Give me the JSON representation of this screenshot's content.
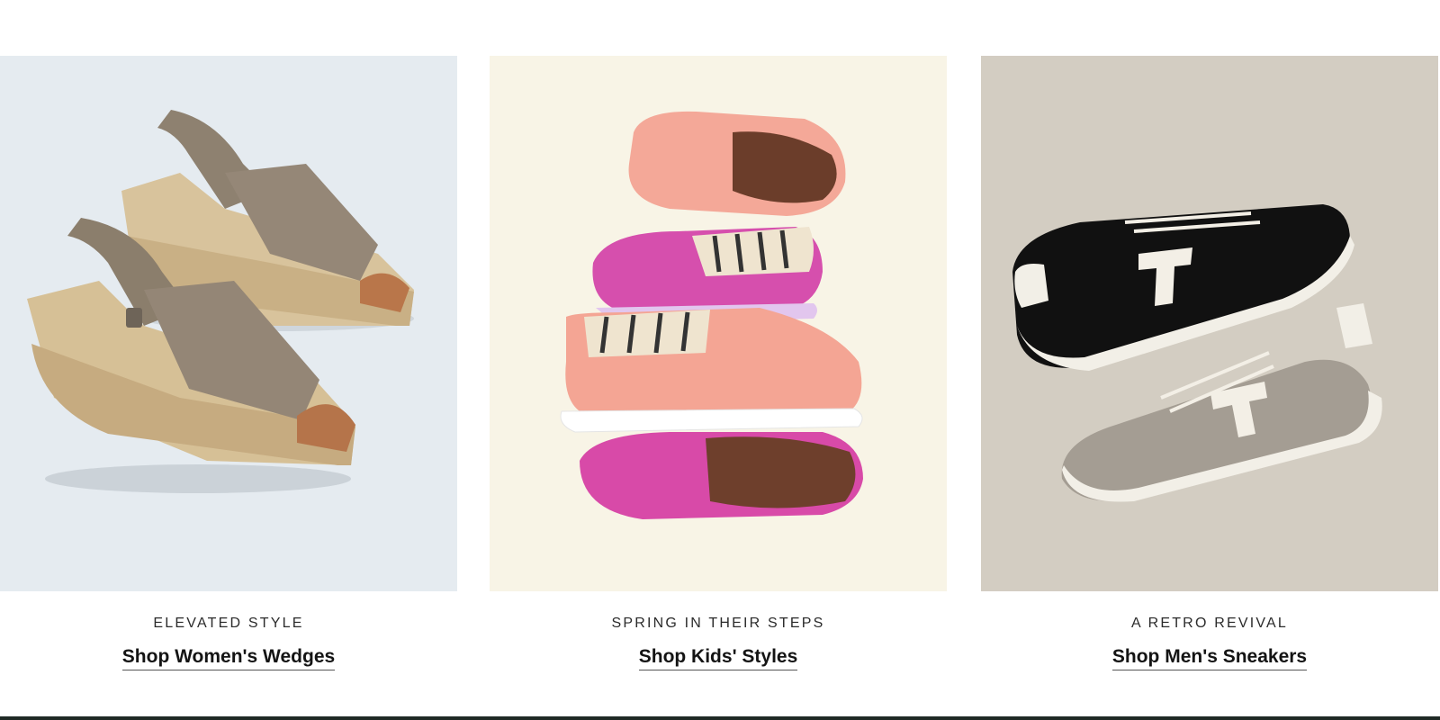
{
  "tiles": [
    {
      "eyebrow": "ELEVATED STYLE",
      "cta": "Shop Women's Wedges",
      "image_icon": "womens-wedge-sandals-photo",
      "background": "#e5ebf0"
    },
    {
      "eyebrow": "SPRING IN THEIR STEPS",
      "cta": "Shop Kids' Styles",
      "image_icon": "kids-slip-on-shoes-photo",
      "background": "#f8f4e6"
    },
    {
      "eyebrow": "A RETRO REVIVAL",
      "cta": "Shop Men's Sneakers",
      "image_icon": "mens-sneakers-photo",
      "background": "#d3cdc2"
    }
  ],
  "colors": {
    "text": "#2b2b2b",
    "link": "#141414",
    "footer_bar": "#1f2a26"
  }
}
